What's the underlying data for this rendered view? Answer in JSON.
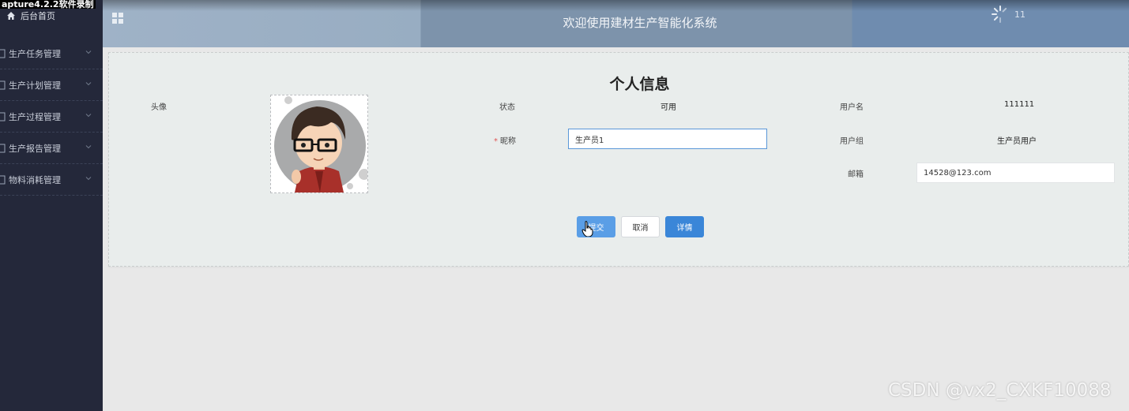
{
  "capture_label": "apture4.2.2软件录制",
  "sidebar": {
    "home_label": "后台首页",
    "items": [
      {
        "label": "生产任务管理"
      },
      {
        "label": "生产计划管理"
      },
      {
        "label": "生产过程管理"
      },
      {
        "label": "生产报告管理"
      },
      {
        "label": "物料消耗管理"
      }
    ]
  },
  "header": {
    "title": "欢迎使用建材生产智能化系统",
    "count": "11"
  },
  "profile": {
    "title": "个人信息",
    "avatar_label": "头像",
    "status_label": "状态",
    "status_value": "可用",
    "username_label": "用户名",
    "username_value": "111111",
    "nickname_label": "昵称",
    "nickname_value": "生产员1",
    "group_label": "用户组",
    "group_value": "生产员用户",
    "email_label": "邮箱",
    "email_value": "14528@123.com"
  },
  "buttons": {
    "submit": "提交",
    "cancel": "取消",
    "details": "详情"
  },
  "watermark": "CSDN @vx2_CXKF10088",
  "colors": {
    "sidebar_bg": "#24283a",
    "primary": "#3a86d8",
    "card_bg": "#e9edec"
  }
}
